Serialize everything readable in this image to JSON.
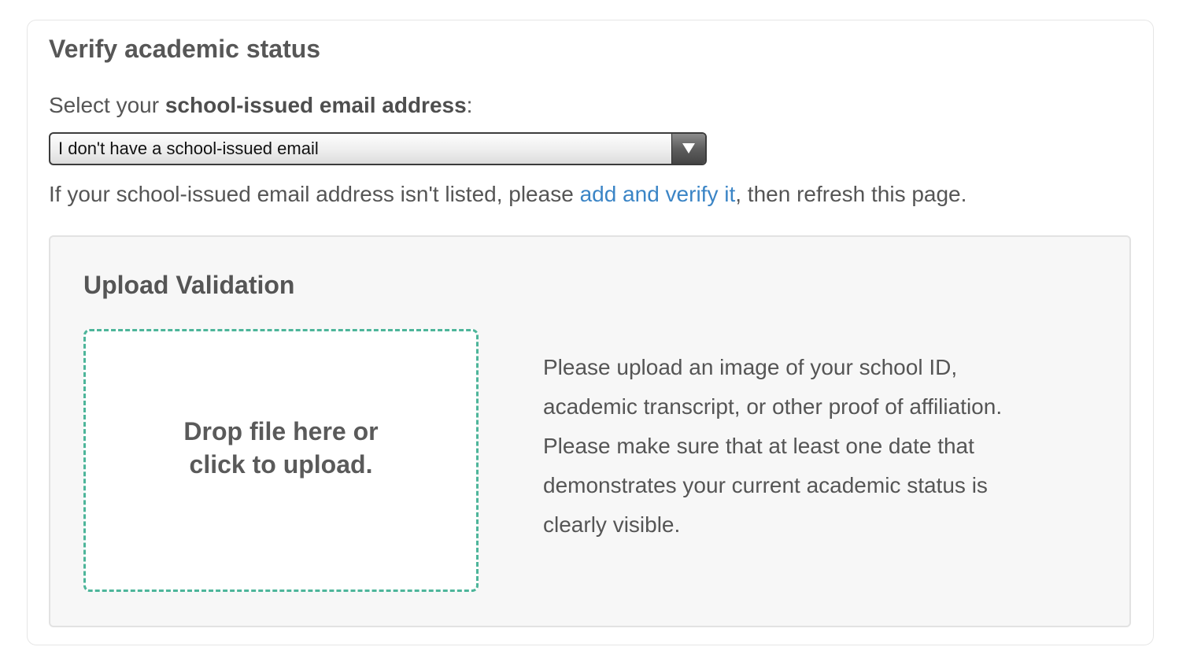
{
  "section": {
    "title": "Verify academic status"
  },
  "email_select": {
    "label_prefix": "Select your ",
    "label_bold": "school-issued email address",
    "label_suffix": ":",
    "selected_value": "I don't have a school-issued email"
  },
  "helper": {
    "text_before": "If your school-issued email address isn't listed, please ",
    "link_text": "add and verify it",
    "text_after": ", then refresh this page."
  },
  "upload": {
    "title": "Upload Validation",
    "dropzone_line1": "Drop file here or",
    "dropzone_line2": "click to upload.",
    "instructions": [
      "Please upload an image of your school ID,",
      "academic transcript, or other proof of affiliation.",
      "Please make sure that at least one date that",
      "demonstrates your current academic status is",
      "clearly visible."
    ]
  },
  "colors": {
    "link": "#3b85c6",
    "dropzone_border": "#4db59a",
    "panel_background": "#f7f7f7"
  },
  "icons": {
    "select_arrow": "triangle-down"
  }
}
